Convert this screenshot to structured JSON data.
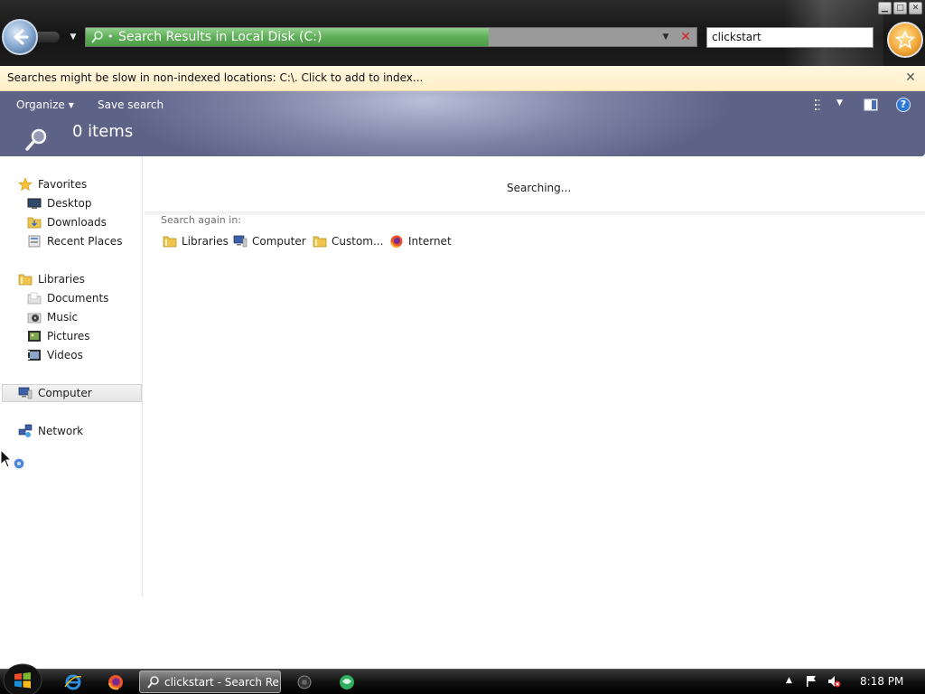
{
  "window": {
    "address_text": "Search Results in Local Disk (C:)",
    "search_value": "clickstart",
    "search_progress_pct": 66
  },
  "infobar": {
    "text": "Searches might be slow in non-indexed locations: C:\\. Click to add to index..."
  },
  "commandbar": {
    "organize_label": "Organize",
    "save_search_label": "Save search"
  },
  "header": {
    "items_count": "0 items"
  },
  "navpane": {
    "favorites": {
      "label": "Favorites",
      "items": [
        {
          "label": "Desktop",
          "icon": "desktop-icon"
        },
        {
          "label": "Downloads",
          "icon": "downloads-folder-icon"
        },
        {
          "label": "Recent Places",
          "icon": "recent-places-icon"
        }
      ]
    },
    "libraries": {
      "label": "Libraries",
      "items": [
        {
          "label": "Documents",
          "icon": "documents-icon"
        },
        {
          "label": "Music",
          "icon": "music-icon"
        },
        {
          "label": "Pictures",
          "icon": "pictures-icon"
        },
        {
          "label": "Videos",
          "icon": "videos-icon"
        }
      ]
    },
    "computer": {
      "label": "Computer",
      "selected": true
    },
    "network": {
      "label": "Network"
    }
  },
  "content": {
    "status": "Searching...",
    "search_again_label": "Search again in:",
    "search_again_items": [
      {
        "label": "Libraries",
        "icon": "libraries-folder-icon"
      },
      {
        "label": "Computer",
        "icon": "computer-icon"
      },
      {
        "label": "Custom...",
        "icon": "custom-folder-icon"
      },
      {
        "label": "Internet",
        "icon": "firefox-icon"
      }
    ]
  },
  "taskbar": {
    "active_task_label": "clickstart - Search Re...",
    "clock": "8:18 PM"
  },
  "colors": {
    "progress_green": "#5fae58",
    "infobar_bg": "#fff3d6",
    "header_bg": "#7d84a6",
    "help_blue": "#2f77d5"
  }
}
